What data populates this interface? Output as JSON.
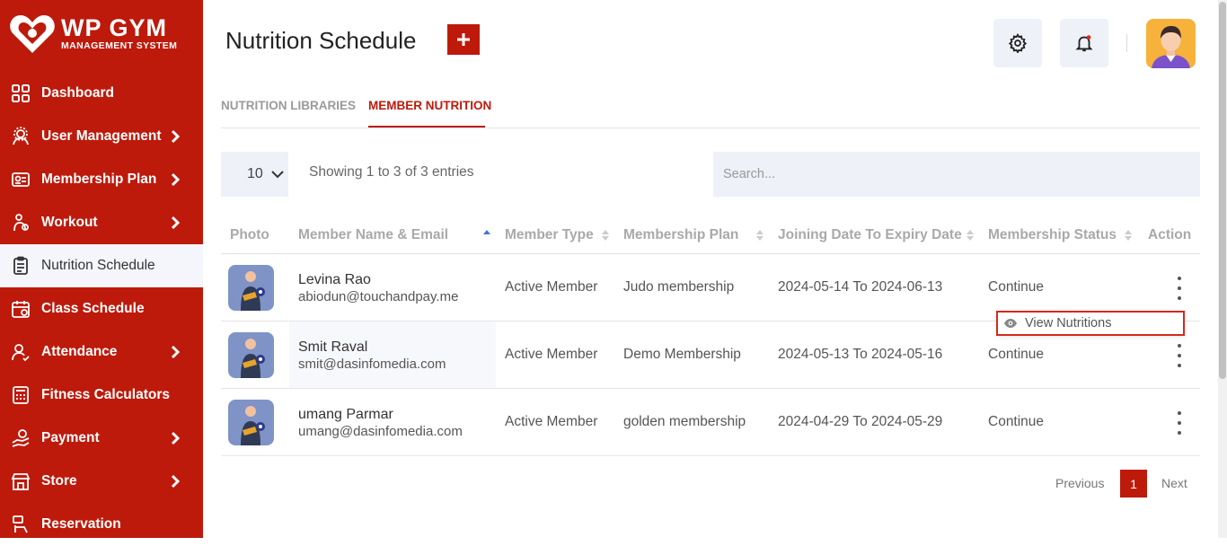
{
  "brand": {
    "title": "WP GYM",
    "subtitle": "MANAGEMENT SYSTEM"
  },
  "sidebar": {
    "items": [
      {
        "label": "Dashboard",
        "icon": "dashboard-grid-icon"
      },
      {
        "label": "User Management",
        "icon": "users-cog-icon",
        "chevron": true
      },
      {
        "label": "Membership Plan",
        "icon": "membership-card-icon",
        "chevron": true
      },
      {
        "label": "Workout",
        "icon": "dumbbell-icon",
        "chevron": true
      },
      {
        "label": "Nutrition Schedule",
        "icon": "clipboard-icon",
        "active": true
      },
      {
        "label": "Class Schedule",
        "icon": "calendar-icon"
      },
      {
        "label": "Attendance",
        "icon": "user-check-icon",
        "chevron": true
      },
      {
        "label": "Fitness Calculators",
        "icon": "calculator-icon"
      },
      {
        "label": "Payment",
        "icon": "payment-hand-icon",
        "chevron": true
      },
      {
        "label": "Store",
        "icon": "store-icon",
        "chevron": true
      },
      {
        "label": "Reservation",
        "icon": "reservation-icon"
      }
    ]
  },
  "header": {
    "title": "Nutrition Schedule",
    "add_label": "+"
  },
  "tabs": [
    {
      "label": "NUTRITION LIBRARIES",
      "active": false
    },
    {
      "label": "MEMBER NUTRITION",
      "active": true
    }
  ],
  "controls": {
    "page_size": "10",
    "info": "Showing 1 to 3 of 3 entries",
    "search_placeholder": "Search..."
  },
  "table": {
    "columns": [
      "Photo",
      "Member Name & Email",
      "Member Type",
      "Membership Plan",
      "Joining Date To Expiry Date",
      "Membership Status",
      "Action"
    ],
    "rows": [
      {
        "name": "Levina Rao",
        "email": "abiodun@touchandpay.me",
        "type": "Active Member",
        "plan": "Judo membership",
        "dates": "2024-05-14 To 2024-06-13",
        "status": "Continue"
      },
      {
        "name": "Smit Raval",
        "email": "smit@dasinfomedia.com",
        "type": "Active Member",
        "plan": "Demo Membership",
        "dates": "2024-05-13 To 2024-05-16",
        "status": "Continue"
      },
      {
        "name": "umang Parmar",
        "email": "umang@dasinfomedia.com",
        "type": "Active Member",
        "plan": "golden membership",
        "dates": "2024-04-29 To 2024-05-29",
        "status": "Continue"
      }
    ]
  },
  "dropdown": {
    "label": "View Nutritions"
  },
  "pagination": {
    "previous": "Previous",
    "current": "1",
    "next": "Next"
  },
  "colors": {
    "primary": "#bd1a0b",
    "panel": "#eef1f8"
  }
}
